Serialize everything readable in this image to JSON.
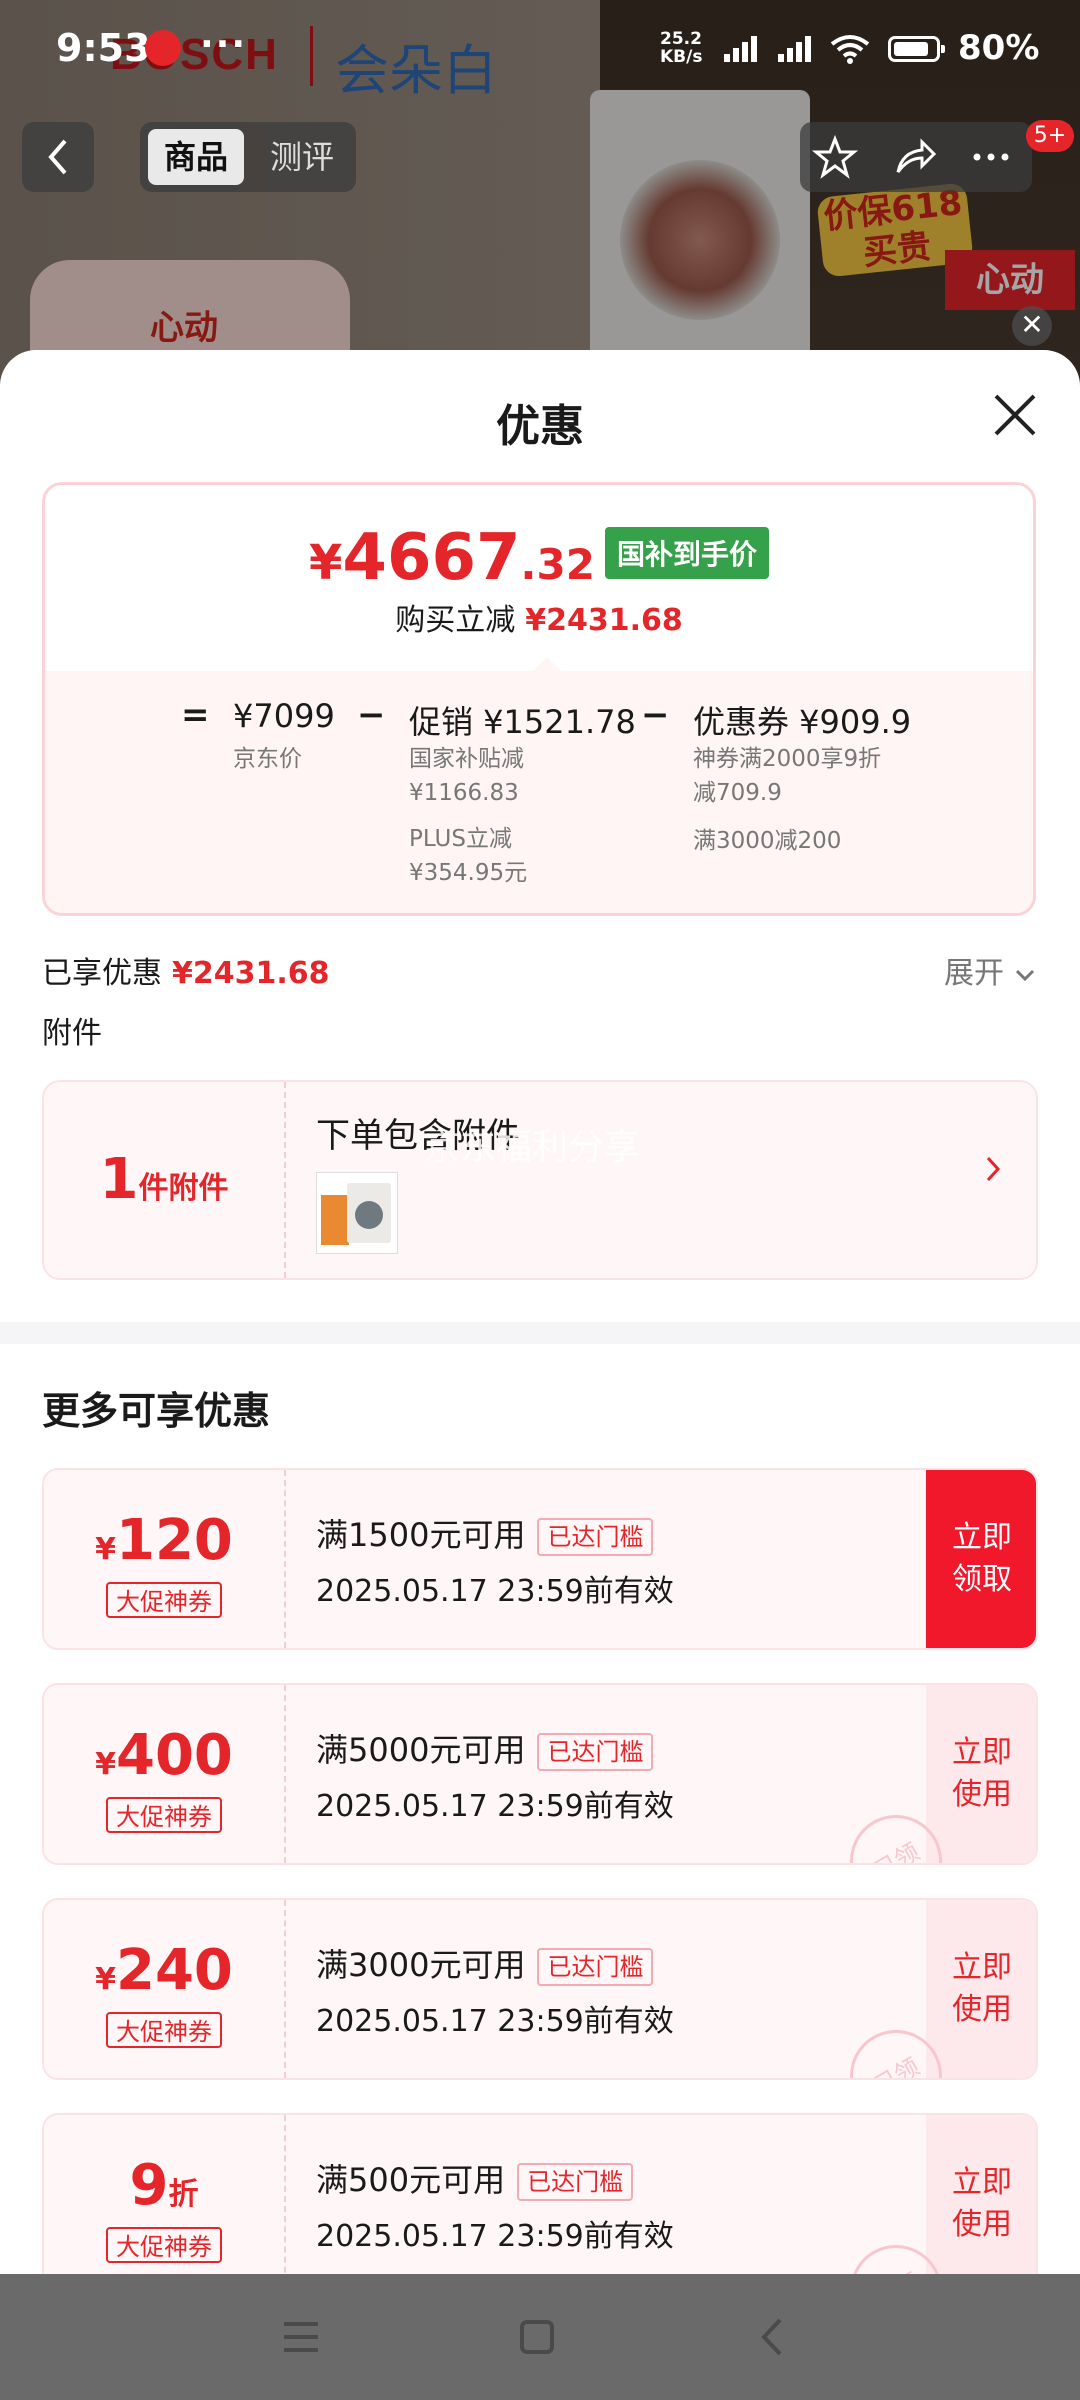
{
  "status_bar": {
    "time": "9:53",
    "more": "···",
    "app_badge": "",
    "speed_value": "25.2",
    "speed_unit": "KB/s",
    "battery": "80%"
  },
  "background": {
    "brand": "BOSCH",
    "brand_cn": "会朵白",
    "promo_top": "价保618",
    "promo_bottom": "买贵",
    "promo_red": "心动",
    "deco_text": "心动"
  },
  "nav": {
    "back_icon": "chevron-left-icon",
    "tabs": [
      "商品",
      "测评"
    ],
    "cart_badge": "5+"
  },
  "sheet": {
    "title": "优惠",
    "summary": {
      "price_symbol": "¥",
      "price_int": "4667",
      "price_dec": ".32",
      "tag": "国补到手价",
      "instant_label": "购买立减",
      "instant_value": "¥2431.68",
      "eq": "=",
      "minus": "−",
      "jd_price": "¥7099",
      "jd_label": "京东价",
      "promo_head": "促销 ¥1521.78",
      "promo_line1": "国家补贴减",
      "promo_line2": "¥1166.83",
      "promo_line3": "PLUS立减",
      "promo_line4": "¥354.95元",
      "coupon_head": "优惠券 ¥909.9",
      "coupon_line1": "神券满2000享9折",
      "coupon_line2": "减709.9",
      "coupon_line3": "满3000减200"
    },
    "enjoyed_label": "已享优惠",
    "enjoyed_value": "¥2431.68",
    "expand_label": "展开",
    "attachment_title": "附件",
    "attachment": {
      "count": "1",
      "unit": "件附件",
      "text": "下单包含附件",
      "watermark": "京东福利分享"
    },
    "more_title": "更多可享优惠",
    "coupons": [
      {
        "symbol": "¥",
        "value": "120",
        "suffix": "",
        "kind": "大促神券",
        "condition": "满1500元可用",
        "reached": "已达门槛",
        "valid": "2025.05.17 23:59前有效",
        "action": "立即领取",
        "stamp": ""
      },
      {
        "symbol": "¥",
        "value": "400",
        "suffix": "",
        "kind": "大促神券",
        "condition": "满5000元可用",
        "reached": "已达门槛",
        "valid": "2025.05.17 23:59前有效",
        "action": "立即使用",
        "stamp": "已领"
      },
      {
        "symbol": "¥",
        "value": "240",
        "suffix": "",
        "kind": "大促神券",
        "condition": "满3000元可用",
        "reached": "已达门槛",
        "valid": "2025.05.17 23:59前有效",
        "action": "立即使用",
        "stamp": "已领"
      },
      {
        "symbol": "",
        "value": "9",
        "suffix": "折",
        "kind": "大促神券",
        "condition": "满500元可用",
        "reached": "已达门槛",
        "valid": "2025.05.17 23:59前有效",
        "action": "立即使用",
        "stamp": "已领"
      }
    ]
  },
  "colors": {
    "accent": "#e4262a",
    "green_tag": "#35a14a",
    "card_bg": "#fff6f7"
  }
}
